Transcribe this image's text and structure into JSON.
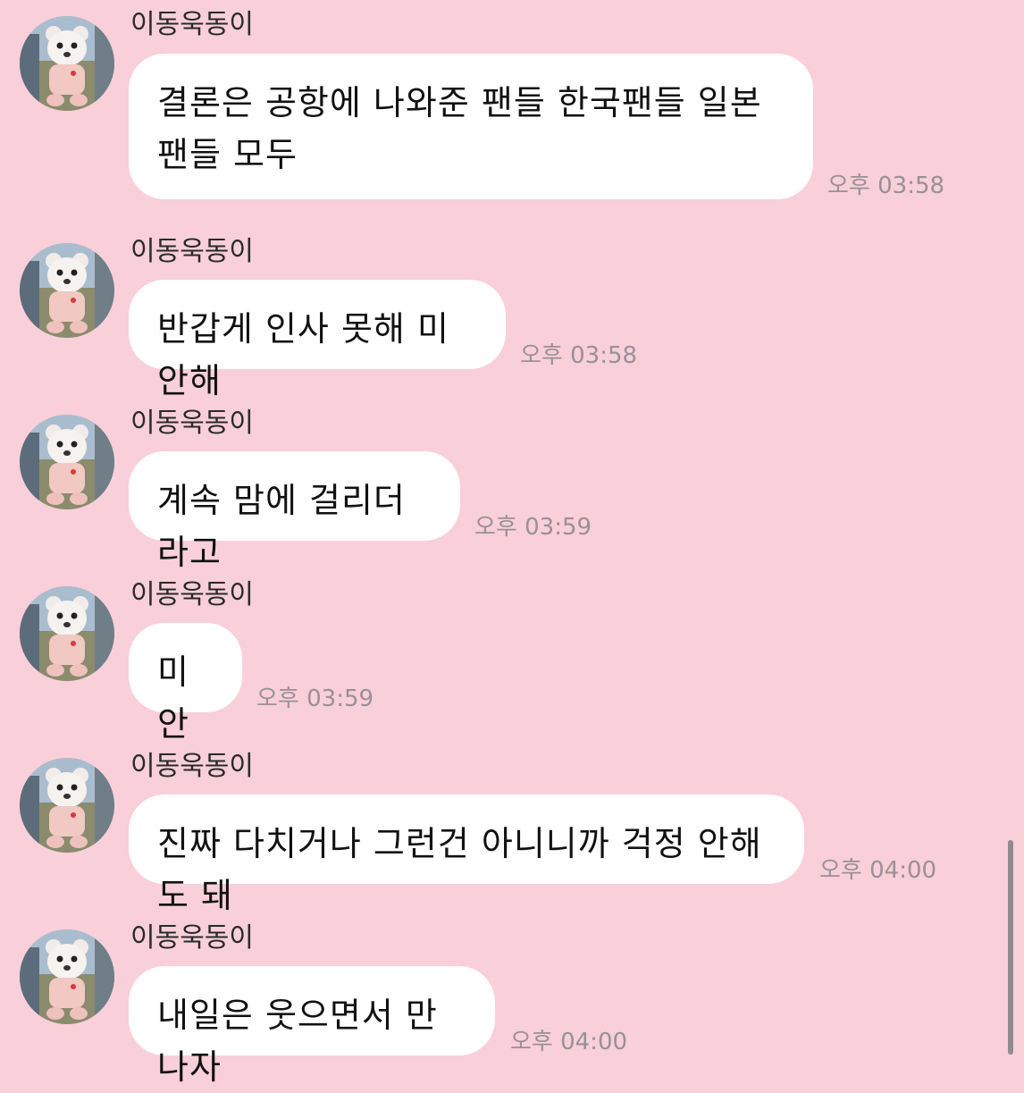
{
  "messages": [
    {
      "sender": "이동욱동이",
      "text": "결론은 공항에 나와준 팬들 한국팬들 일본팬들 모두",
      "time": "오후 03:58"
    },
    {
      "sender": "이동욱동이",
      "text": "반갑게 인사 못해 미안해",
      "time": "오후 03:58"
    },
    {
      "sender": "이동욱동이",
      "text": "계속 맘에 걸리더라고",
      "time": "오후 03:59"
    },
    {
      "sender": "이동욱동이",
      "text": "미안",
      "time": "오후 03:59"
    },
    {
      "sender": "이동욱동이",
      "text": "진짜 다치거나 그런건 아니니까 걱정 안해도 돼",
      "time": "오후 04:00"
    },
    {
      "sender": "이동욱동이",
      "text": "내일은 웃으면서 만나자",
      "time": "오후 04:00"
    }
  ],
  "avatar_icon": "teddy-bear-plush-avatar",
  "colors": {
    "background": "#f9cfd9",
    "bubble": "#ffffff",
    "timestamp": "#9a9097"
  }
}
